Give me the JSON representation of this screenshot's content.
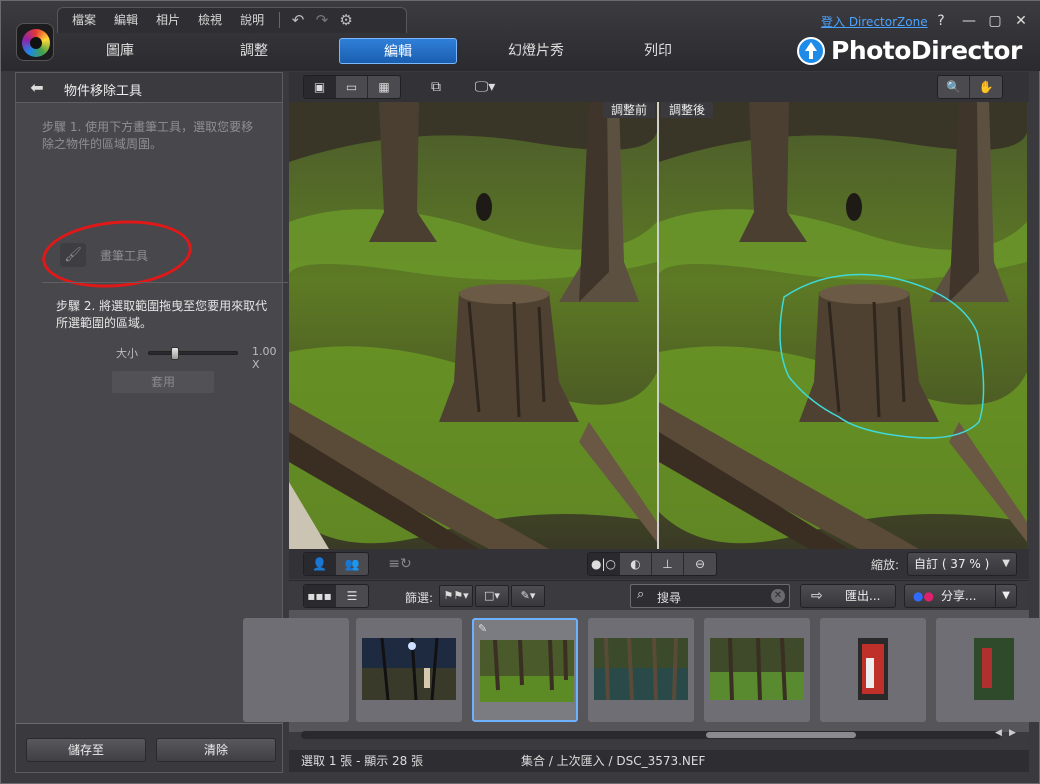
{
  "menu": {
    "items": [
      "檔案",
      "編輯",
      "相片",
      "檢視",
      "說明"
    ]
  },
  "signin": "登入 DirectorZone",
  "window_buttons": {
    "help": "?",
    "minimize": "—",
    "maximize": "▢",
    "close": "✕"
  },
  "modes": [
    "圖庫",
    "調整",
    "編輯",
    "幻燈片秀",
    "列印"
  ],
  "active_mode": "編輯",
  "brand": "PhotoDirector",
  "left_panel": {
    "title": "物件移除工具",
    "step1": "步驟 1. 使用下方畫筆工具，選取您要移除之物件的區域周圍。",
    "brush_tool": "畫筆工具",
    "step2": "步驟 2. 將選取範圍拖曳至您要用來取代所選範圍的區域。",
    "size_label": "大小",
    "size_value": "1.00",
    "size_unit": "X",
    "size_slider_fraction": 0.28,
    "apply": "套用",
    "save_to": "儲存至",
    "clear": "清除"
  },
  "viewer": {
    "label_before": "調整前",
    "label_after": "調整後"
  },
  "zoom": {
    "label": "縮放:",
    "value": "自訂 ( 37 % )"
  },
  "browser": {
    "filter_label": "篩選:",
    "search_placeholder": "搜尋",
    "export": "匯出...",
    "share": "分享..."
  },
  "status": {
    "selection": "選取 1 張 - 顯示 28 張",
    "path": "集合 / 上次匯入 / DSC_3573.NEF"
  },
  "colors": {
    "accent": "#1f8be8",
    "selection_outline": "#3fd9d9",
    "annotation": "#e01818"
  }
}
